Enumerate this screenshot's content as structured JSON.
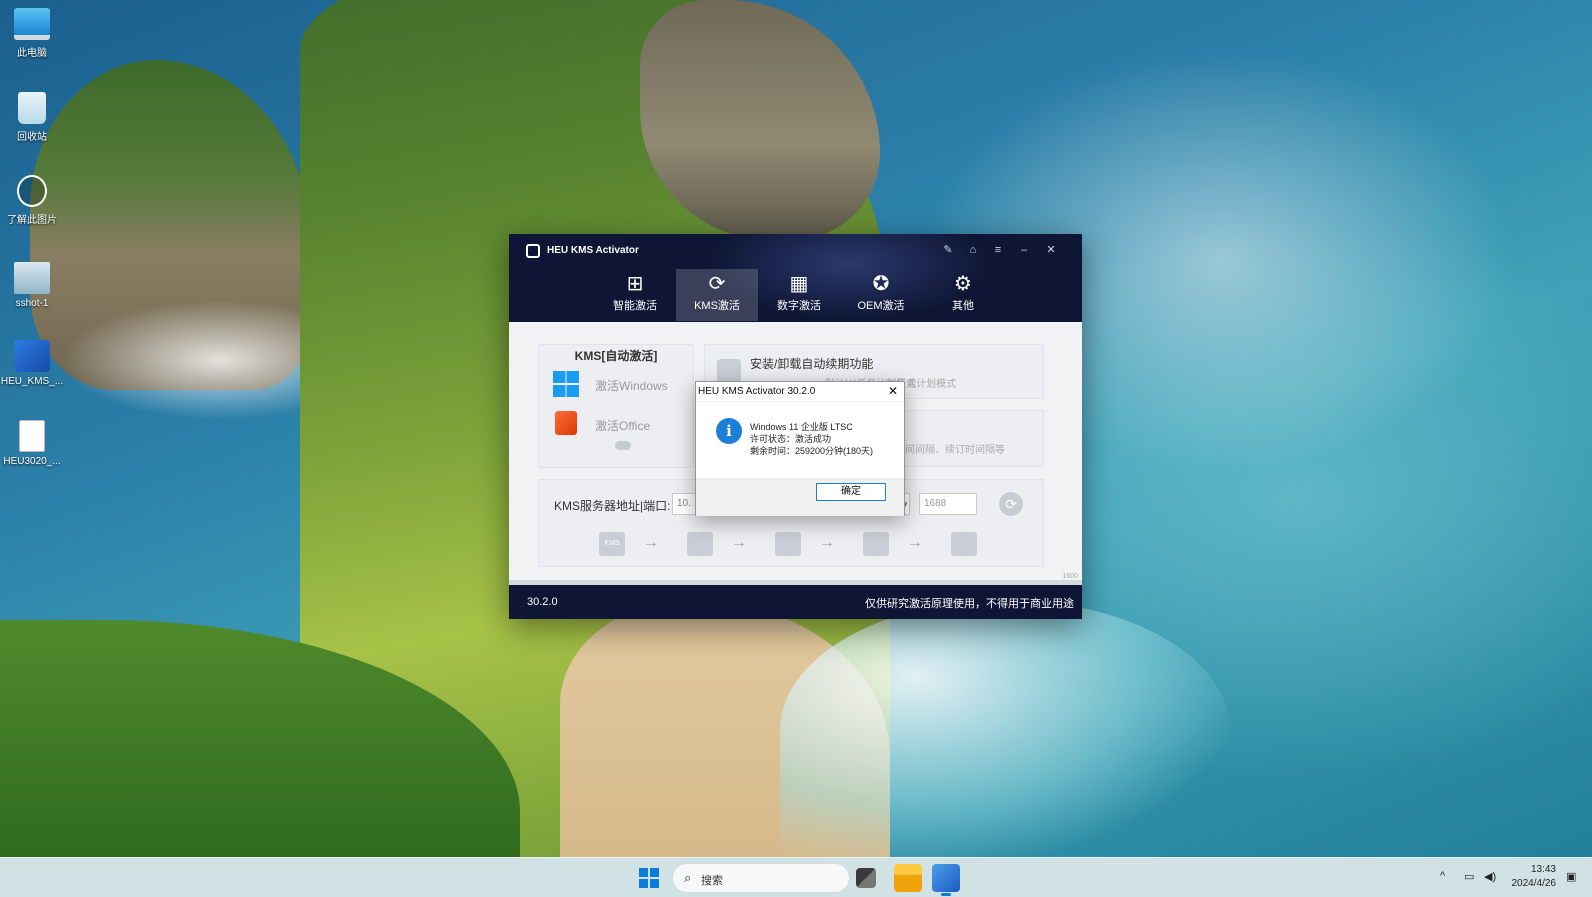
{
  "desktop": {
    "icons": [
      {
        "label": "此电脑",
        "icon": "computer-icon"
      },
      {
        "label": "回收站",
        "icon": "recycle-bin-icon"
      },
      {
        "label": "了解此图片",
        "icon": "learn-photo-icon"
      },
      {
        "label": "sshot-1",
        "icon": "image-file-icon"
      },
      {
        "label": "HEU_KMS_...",
        "icon": "app-shortcut-icon"
      },
      {
        "label": "HEU3020_...",
        "icon": "document-icon"
      }
    ]
  },
  "window": {
    "title": "HEU KMS Activator",
    "controls": [
      "✎",
      "⌂",
      "≡",
      "–",
      "✕"
    ],
    "tabs": [
      {
        "label": "智能激活",
        "icon": "windows-grid-icon",
        "glyph": "⊞"
      },
      {
        "label": "KMS激活",
        "icon": "kms-icon",
        "glyph": "⟳"
      },
      {
        "label": "数字激活",
        "icon": "digital-icon",
        "glyph": "▦"
      },
      {
        "label": "OEM激活",
        "icon": "oem-icon",
        "glyph": "✪"
      },
      {
        "label": "其他",
        "icon": "gear-icon",
        "glyph": "⚙"
      }
    ],
    "active_tab": "KMS激活",
    "kms_panel": {
      "title": "KMS[自动激活]",
      "activate_windows": "激活Windows",
      "activate_office": "激活Office"
    },
    "auto_panel": {
      "title": "安装/卸载自动续期功能",
      "subtitle": "默认[1]任务计划模式",
      "full_subtitle": "[2]任务计划模式"
    },
    "option_panel": {
      "subtitle": "时间间隔、续订时间隔等"
    },
    "server": {
      "label": "KMS服务器地址|端口:",
      "address": "10.",
      "port_placeholder": "1688",
      "refresh_glyph": "⟳"
    },
    "flow": [
      {
        "icon": "kms-server-icon",
        "text": "KMS"
      },
      {
        "icon": "activate-icon",
        "text": ""
      },
      {
        "icon": "windows-icon",
        "text": ""
      },
      {
        "icon": "office-icon",
        "text": ""
      },
      {
        "icon": "power-icon",
        "text": ""
      }
    ],
    "flow_arrow": "→",
    "build_tag": "1600",
    "footer": {
      "version": "30.2.0",
      "note": "仅供研究激活原理使用，不得用于商业用途"
    }
  },
  "dialog": {
    "title": "HEU KMS Activator 30.2.0",
    "close": "✕",
    "icon_glyph": "i",
    "lines": [
      "Windows 11 企业版 LTSC",
      "许可状态：激活成功",
      "剩余时间：259200分钟(180天)"
    ],
    "ok_label": "确定"
  },
  "taskbar": {
    "search_placeholder": "搜索",
    "search_glyph": "⌕",
    "tray_chevron": "^",
    "tray_network": "▭",
    "tray_volume": "◀)",
    "time": "13:43",
    "date": "2024/4/26",
    "notification_glyph": "▣"
  }
}
